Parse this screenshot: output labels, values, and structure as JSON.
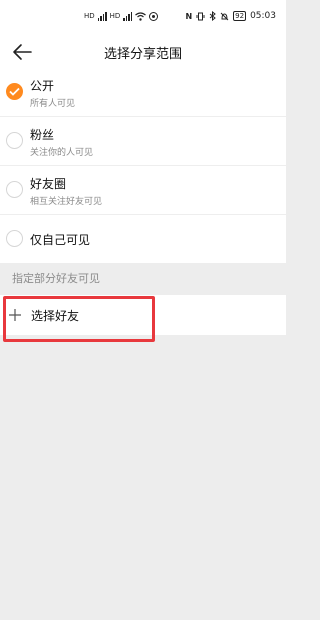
{
  "status_bar": {
    "left_icons": [
      "sim-hd-icon",
      "signal-icon",
      "sim-hd-icon",
      "signal-icon",
      "wifi-icon",
      "message-icon"
    ],
    "right_icons": [
      "nfc-icon",
      "vibrate-icon",
      "bluetooth-icon",
      "alarm-off-icon",
      "battery-icon"
    ],
    "battery": "92",
    "time": "05:03"
  },
  "header": {
    "title": "选择分享范围",
    "back_icon": "back-arrow-icon"
  },
  "options": [
    {
      "title": "公开",
      "subtitle": "所有人可见",
      "checked": true
    },
    {
      "title": "粉丝",
      "subtitle": "关注你的人可见",
      "checked": false
    },
    {
      "title": "好友圈",
      "subtitle": "相互关注好友可见",
      "checked": false
    },
    {
      "title": "仅自己可见",
      "subtitle": "",
      "checked": false
    }
  ],
  "section": {
    "label": "指定部分好友可见"
  },
  "select_friends": {
    "label": "选择好友",
    "icon": "plus-icon"
  },
  "colors": {
    "accent": "#ff8a1f",
    "highlight_border": "#e8383d",
    "background": "#ededed"
  }
}
